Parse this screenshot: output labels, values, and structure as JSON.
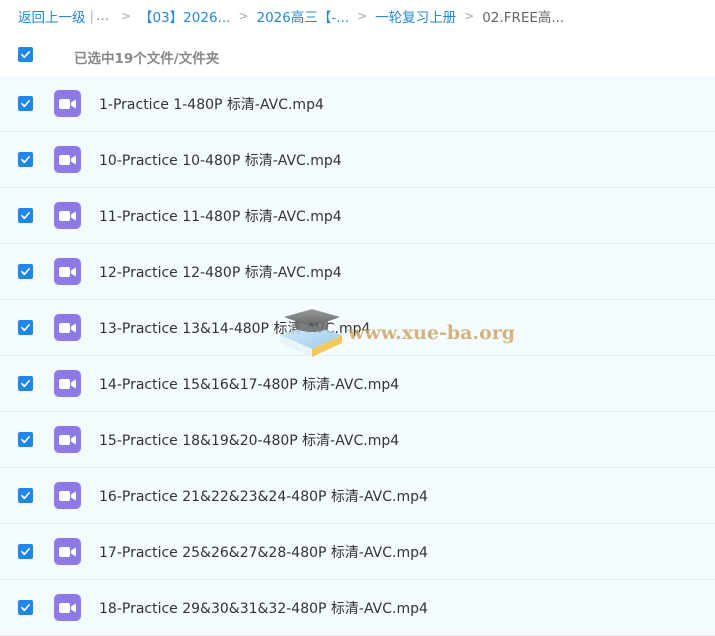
{
  "breadcrumb": {
    "back": "返回上一级",
    "pipe": "|",
    "ellipsis": "...",
    "separator": ">",
    "items": [
      "【03】2026...",
      "2026高三【-...",
      "一轮复习上册"
    ],
    "current": "02.FREE高..."
  },
  "selection": {
    "summary": "已选中19个文件/文件夹",
    "all_checked": true
  },
  "files": [
    {
      "name": "1-Practice 1-480P 标清-AVC.mp4",
      "checked": true,
      "icon": "video-file-icon"
    },
    {
      "name": "10-Practice 10-480P 标清-AVC.mp4",
      "checked": true,
      "icon": "video-file-icon"
    },
    {
      "name": "11-Practice 11-480P 标清-AVC.mp4",
      "checked": true,
      "icon": "video-file-icon"
    },
    {
      "name": "12-Practice 12-480P 标清-AVC.mp4",
      "checked": true,
      "icon": "video-file-icon"
    },
    {
      "name": "13-Practice 13&14-480P 标清-AVC.mp4",
      "checked": true,
      "icon": "video-file-icon"
    },
    {
      "name": "14-Practice 15&16&17-480P 标清-AVC.mp4",
      "checked": true,
      "icon": "video-file-icon"
    },
    {
      "name": "15-Practice 18&19&20-480P 标清-AVC.mp4",
      "checked": true,
      "icon": "video-file-icon"
    },
    {
      "name": "16-Practice 21&22&23&24-480P 标清-AVC.mp4",
      "checked": true,
      "icon": "video-file-icon"
    },
    {
      "name": "17-Practice 25&26&27&28-480P 标清-AVC.mp4",
      "checked": true,
      "icon": "video-file-icon"
    },
    {
      "name": "18-Practice 29&30&31&32-480P 标清-AVC.mp4",
      "checked": true,
      "icon": "video-file-icon"
    }
  ],
  "watermark": {
    "text": "www.xue-ba.org"
  },
  "colors": {
    "link": "#2389d6",
    "checkbox": "#1f87e8",
    "video_icon": "#8d79e8",
    "row_bg": "#f4fbfe"
  }
}
